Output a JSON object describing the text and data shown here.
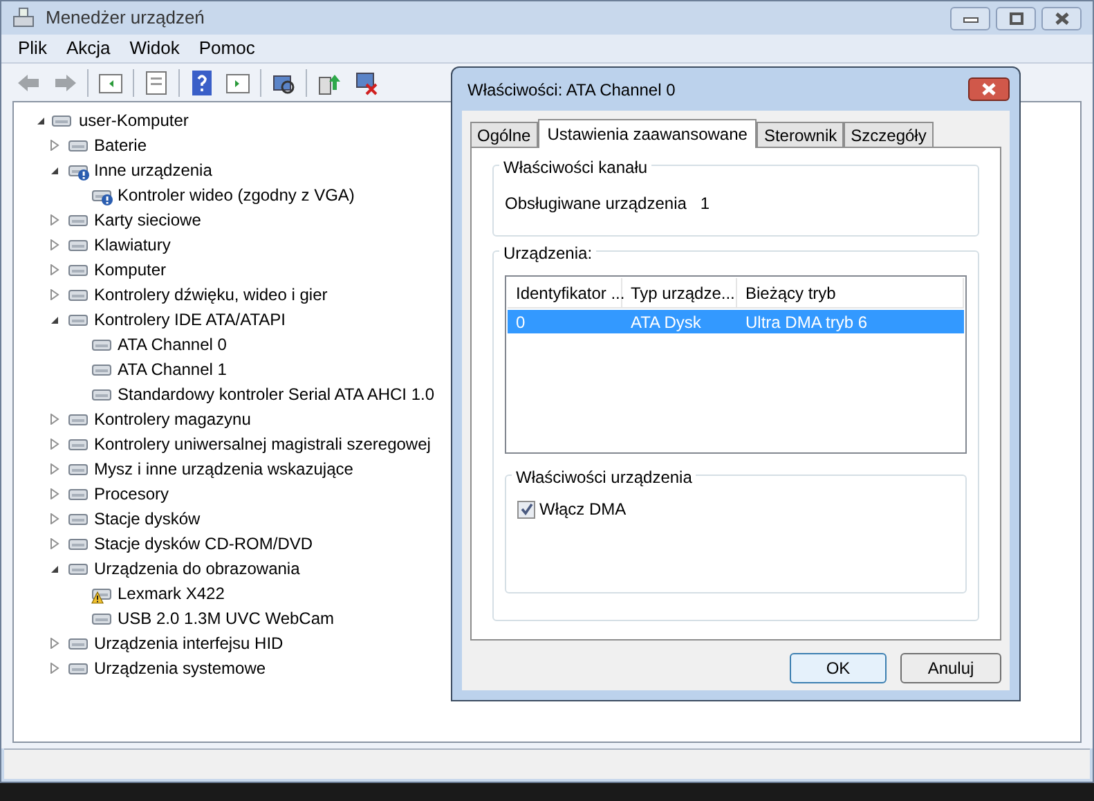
{
  "window": {
    "title": "Menedżer urządzeń"
  },
  "menu": [
    "Plik",
    "Akcja",
    "Widok",
    "Pomoc"
  ],
  "tree": {
    "label": "user-Komputer",
    "expanded": true,
    "children": [
      {
        "label": "Baterie",
        "expanded": false,
        "unknown": false,
        "warning": false
      },
      {
        "label": "Inne urządzenia",
        "expanded": true,
        "unknown": true,
        "warning": false,
        "children": [
          {
            "label": "Kontroler wideo (zgodny z VGA)",
            "unknown": true,
            "warning": false
          }
        ]
      },
      {
        "label": "Karty sieciowe",
        "expanded": false,
        "unknown": false,
        "warning": false
      },
      {
        "label": "Klawiatury",
        "expanded": false,
        "unknown": false,
        "warning": false
      },
      {
        "label": "Komputer",
        "expanded": false,
        "unknown": false,
        "warning": false
      },
      {
        "label": "Kontrolery dźwięku, wideo i gier",
        "expanded": false,
        "unknown": false,
        "warning": false
      },
      {
        "label": "Kontrolery IDE ATA/ATAPI",
        "expanded": true,
        "unknown": false,
        "warning": false,
        "children": [
          {
            "label": "ATA Channel 0",
            "unknown": false,
            "warning": false
          },
          {
            "label": "ATA Channel 1",
            "unknown": false,
            "warning": false
          },
          {
            "label": "Standardowy kontroler Serial ATA AHCI 1.0",
            "unknown": false,
            "warning": false
          }
        ]
      },
      {
        "label": "Kontrolery magazynu",
        "expanded": false,
        "unknown": false,
        "warning": false
      },
      {
        "label": "Kontrolery uniwersalnej magistrali szeregowej",
        "expanded": false,
        "unknown": false,
        "warning": false
      },
      {
        "label": "Mysz i inne urządzenia wskazujące",
        "expanded": false,
        "unknown": false,
        "warning": false
      },
      {
        "label": "Procesory",
        "expanded": false,
        "unknown": false,
        "warning": false
      },
      {
        "label": "Stacje dysków",
        "expanded": false,
        "unknown": false,
        "warning": false
      },
      {
        "label": "Stacje dysków CD-ROM/DVD",
        "expanded": false,
        "unknown": false,
        "warning": false
      },
      {
        "label": "Urządzenia do obrazowania",
        "expanded": true,
        "unknown": false,
        "warning": false,
        "children": [
          {
            "label": "Lexmark X422",
            "unknown": false,
            "warning": true
          },
          {
            "label": "USB 2.0 1.3M UVC WebCam",
            "unknown": false,
            "warning": false
          }
        ]
      },
      {
        "label": "Urządzenia interfejsu HID",
        "expanded": false,
        "unknown": false,
        "warning": false
      },
      {
        "label": "Urządzenia systemowe",
        "expanded": false,
        "unknown": false,
        "warning": false
      }
    ]
  },
  "dialog": {
    "title": "Właściwości: ATA Channel 0",
    "tabs": [
      {
        "label": "Ogólne",
        "selected": false
      },
      {
        "label": "Ustawienia zaawansowane",
        "selected": true
      },
      {
        "label": "Sterownik",
        "selected": false
      },
      {
        "label": "Szczegóły",
        "selected": false
      }
    ],
    "channel_group": {
      "title": "Właściwości kanału",
      "label": "Obsługiwane urządzenia",
      "value": "1"
    },
    "devices_group": {
      "title": "Urządzenia:",
      "columns": [
        "Identyfikator ...",
        "Typ urządze...",
        "Bieżący tryb"
      ],
      "rows": [
        {
          "cells": [
            "0",
            "ATA Dysk",
            "Ultra DMA tryb 6"
          ],
          "selected": true
        }
      ],
      "device_props": {
        "title": "Właściwości urządzenia",
        "checkbox": {
          "label": "Włącz DMA",
          "checked": true
        }
      }
    },
    "buttons": [
      "OK",
      "Anuluj"
    ]
  }
}
